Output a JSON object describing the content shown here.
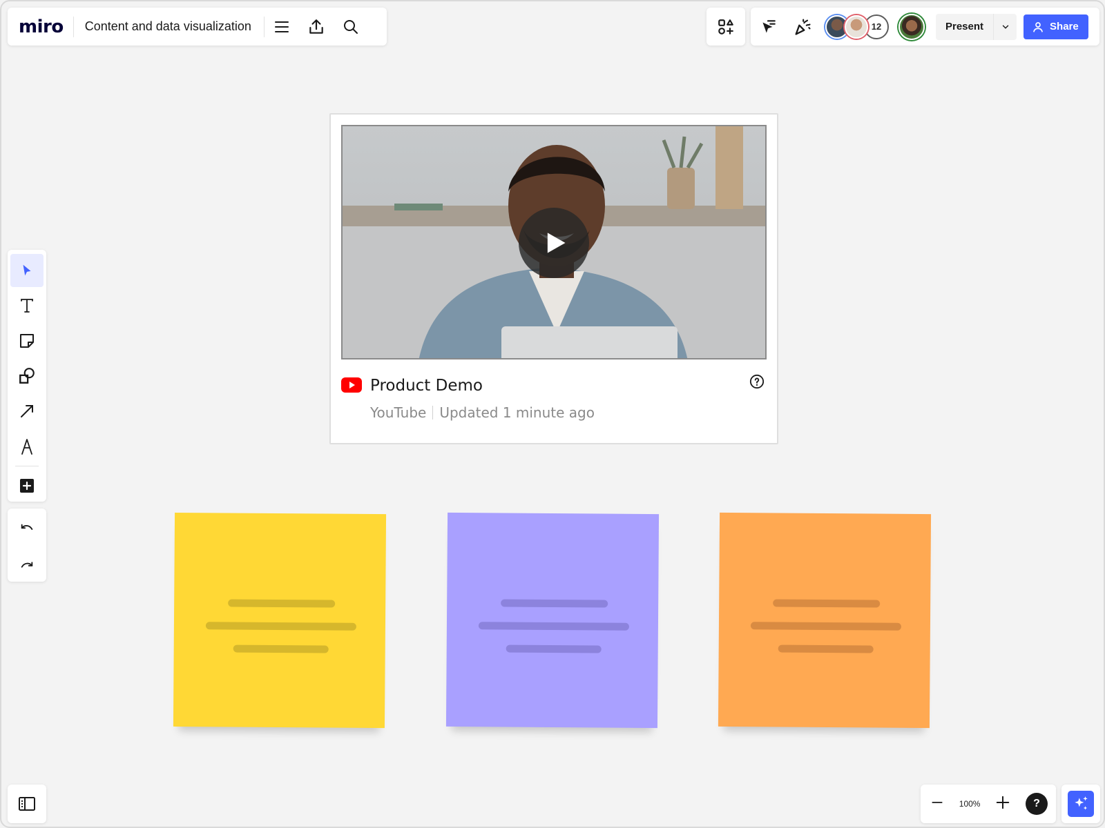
{
  "app": {
    "logo": "miro",
    "board_title": "Content and data visualization"
  },
  "topbar": {
    "icons": [
      "menu-icon",
      "export-icon",
      "search-icon"
    ],
    "collaborator_count": "12",
    "present_label": "Present",
    "share_label": "Share"
  },
  "toolbar": {
    "tools": [
      "select-icon",
      "text-icon",
      "sticky-note-icon",
      "shapes-icon",
      "arrow-icon",
      "pen-icon",
      "add-icon"
    ],
    "history": [
      "undo-icon",
      "redo-icon"
    ]
  },
  "embed": {
    "title": "Product Demo",
    "source": "YouTube",
    "updated": "Updated 1 minute ago"
  },
  "stickies": [
    {
      "color": "#ffd835",
      "line_color": "#d6b72c"
    },
    {
      "color": "#a9a0ff",
      "line_color": "#8c83dd"
    },
    {
      "color": "#ffa952",
      "line_color": "#d98b42"
    }
  ],
  "zoom": {
    "level": "100%",
    "help_label": "?"
  },
  "colors": {
    "accent": "#4262ff",
    "canvas": "#f3f3f3",
    "youtube_red": "#ff0000"
  }
}
